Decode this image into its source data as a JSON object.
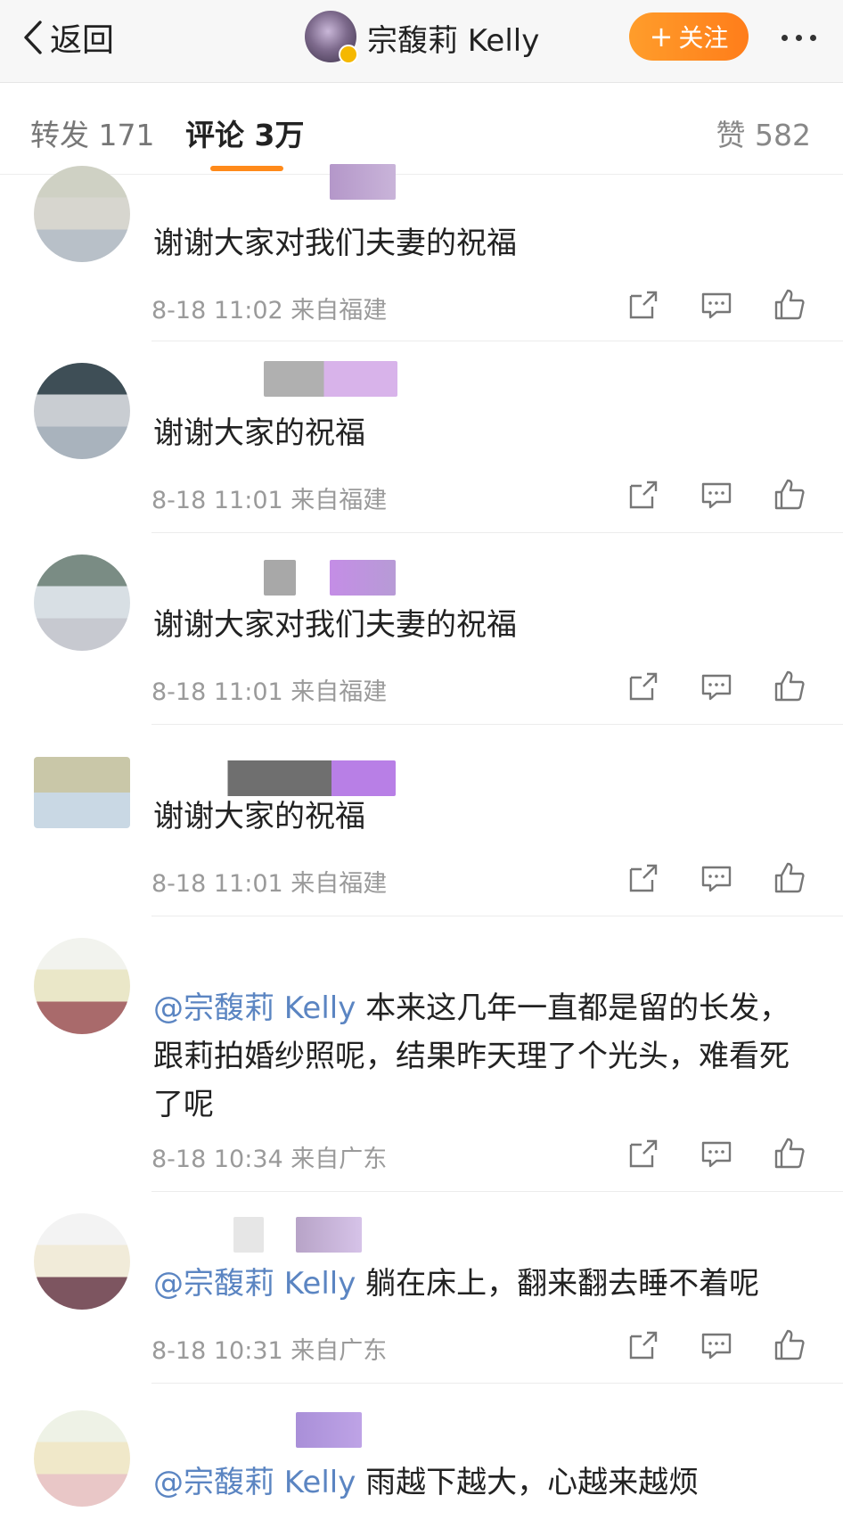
{
  "header": {
    "back_label": "返回",
    "title": "宗馥莉 Kelly",
    "follow_label": "关注"
  },
  "tabs": {
    "repost": "转发 171",
    "comment": "评论 3万",
    "like": "赞 582"
  },
  "comments": [
    {
      "text": "谢谢大家对我们夫妻的祝福",
      "time": "8-18 11:02",
      "location": "来自福建"
    },
    {
      "text": "谢谢大家的祝福",
      "time": "8-18 11:01",
      "location": "来自福建"
    },
    {
      "text": "谢谢大家对我们夫妻的祝福",
      "time": "8-18 11:01",
      "location": "来自福建"
    },
    {
      "text": "谢谢大家的祝福",
      "time": "8-18 11:01",
      "location": "来自福建"
    },
    {
      "mention": "@宗馥莉 Kelly",
      "text": " 本来这几年一直都是留的长发，跟莉拍婚纱照呢，结果昨天理了个光头，难看死了呢",
      "time": "8-18 10:34",
      "location": "来自广东"
    },
    {
      "mention": "@宗馥莉 Kelly",
      "text": " 躺在床上，翻来翻去睡不着呢",
      "time": "8-18 10:31",
      "location": "来自广东"
    },
    {
      "mention": "@宗馥莉 Kelly",
      "text": " 雨越下越大，心越来越烦"
    }
  ],
  "icons": {
    "back": "chevron-left-icon",
    "share": "share-icon",
    "reply": "comment-icon",
    "like": "thumbs-up-icon",
    "more": "more-icon"
  },
  "colors": {
    "accent": "#ff8a1a",
    "mention": "#5b85c2",
    "meta": "#9a9a9a"
  }
}
